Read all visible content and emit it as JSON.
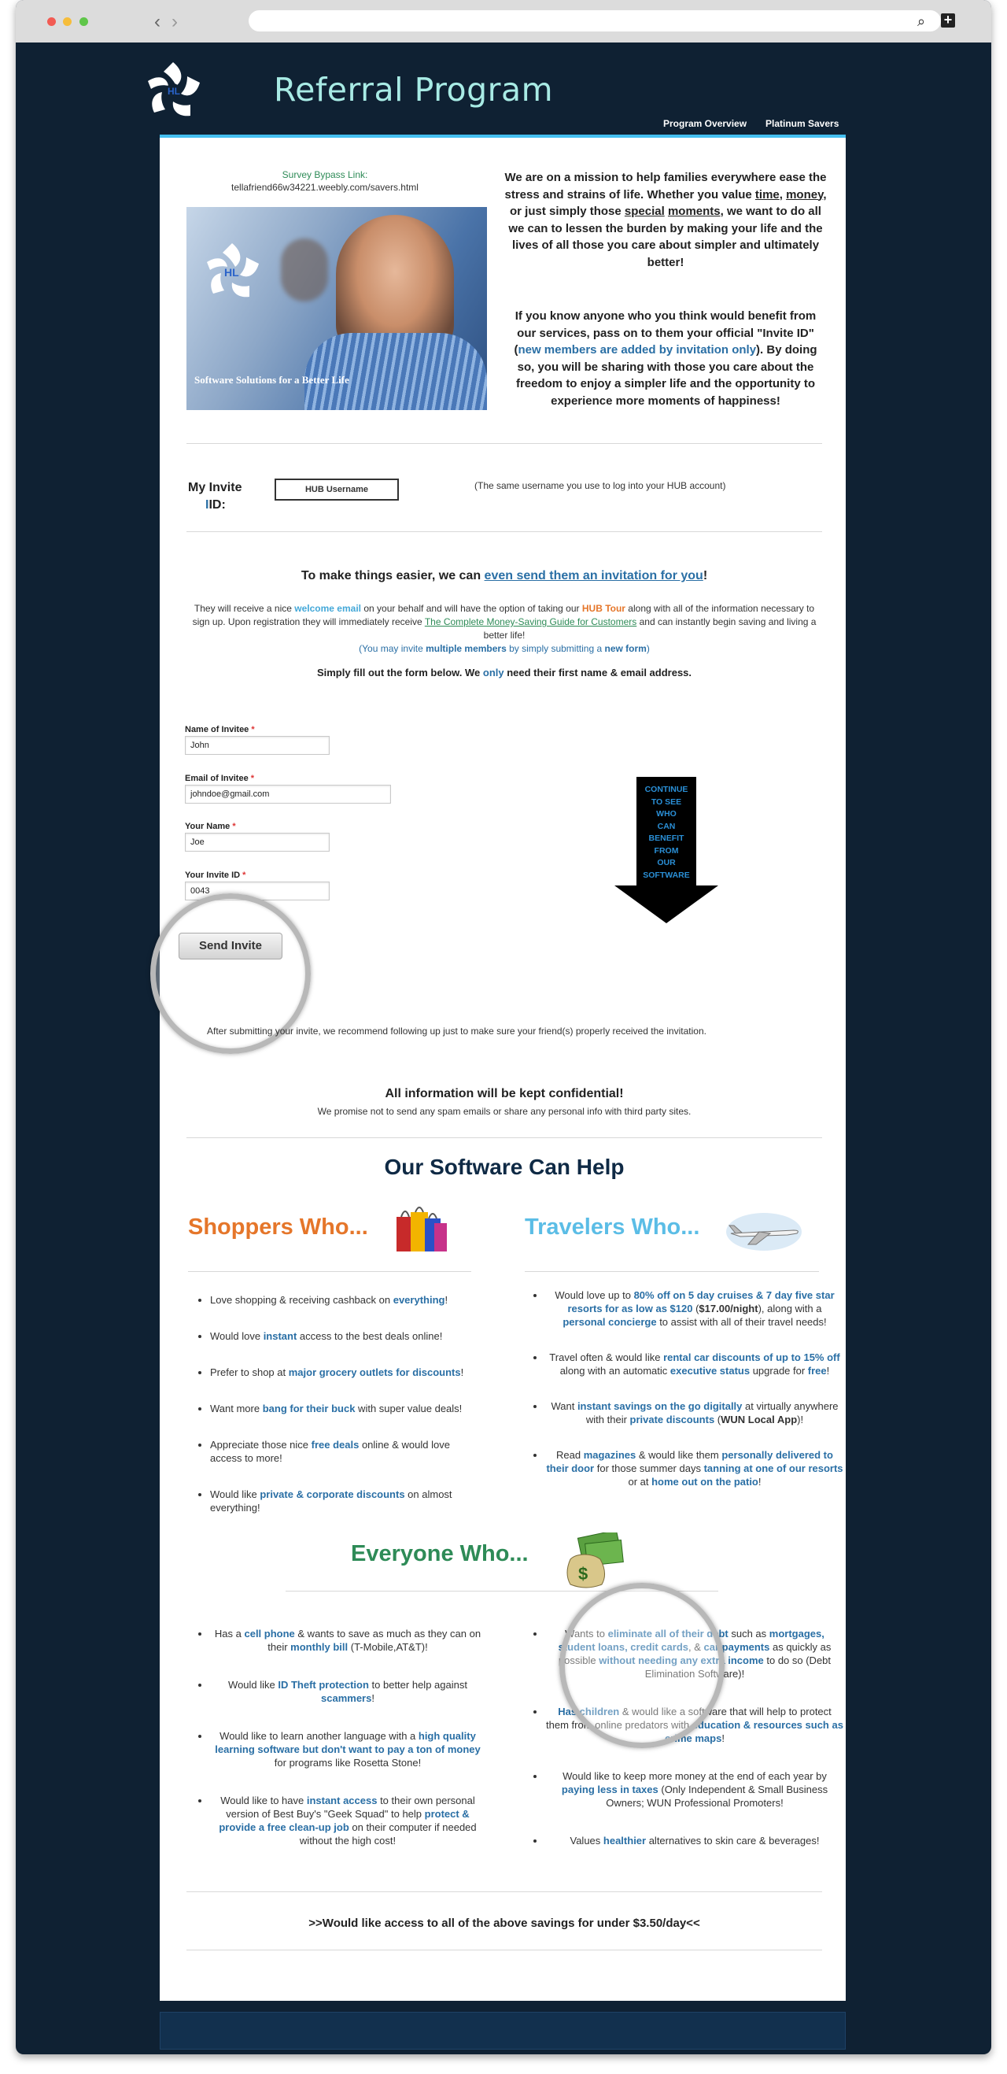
{
  "site": {
    "title": "Referral Program",
    "nav": [
      "Program Overview",
      "Platinum Savers"
    ]
  },
  "survey": {
    "label": "Survey Bypass Link:",
    "url": "tellafriend66w34221.weebly.com/savers.html"
  },
  "hero": {
    "caption": "Software Solutions for a Better Life",
    "logo_text": "HL"
  },
  "mission": {
    "p1": [
      "We are on a mission to help families everywhere ease the stress and strains of life. Whether you value ",
      "time",
      ", ",
      "money",
      ", or just simply those ",
      "special",
      " ",
      "moments",
      ", we want to do all we can to lessen the burden by making your life and the lives of all those you care about simpler and ultimately better!"
    ],
    "p2": [
      "If you know anyone who you think would benefit from our services, pass on to them your official \"Invite ID\" (",
      "new members are added by invitation only",
      "). By doing so, you will be sharing with those you care about the freedom to enjoy a simpler life and the opportunity to experience more moments of happiness!"
    ]
  },
  "invite_id": {
    "label_line1": "My Invite",
    "label_line2": "ID:",
    "box": "HUB Username",
    "note": "(The same username you use to log into your HUB account)"
  },
  "easier": {
    "lead": "To make things easier, we can ",
    "link": "even send them an invitation for you",
    "end": "!"
  },
  "info": {
    "a": "They will receive a nice ",
    "welcome": "welcome email",
    "b": " on your behalf and will have the option of taking our ",
    "tour": "HUB Tour",
    "c": " along with all of the information necessary to sign up. Upon registration they will immediately receive ",
    "guide": "The Complete Money-Saving Guide for Customers",
    "d": " and can instantly begin saving and living a better life!",
    "e": "(You may invite ",
    "multi": "multiple members",
    "f": " by simply submitting a ",
    "newform": "new form",
    "g": ")"
  },
  "fill": {
    "a": "Simply fill out the form below. We ",
    "only": "only",
    "b": " need their first name & email address."
  },
  "form": {
    "name_label": "Name of Invitee",
    "name_value": "John",
    "email_label": "Email of Invitee",
    "email_value": "johndoe@gmail.com",
    "your_name_label": "Your Name",
    "your_name_value": "Joe",
    "your_id_label": "Your Invite ID",
    "your_id_value": "0043",
    "required_mark": "*",
    "submit": "Send Invite"
  },
  "arrow": {
    "text": [
      "CONTINUE",
      "TO SEE",
      "WHO",
      "CAN",
      "BENEFIT",
      "FROM",
      "OUR",
      "SOFTWARE"
    ]
  },
  "follow_up": "After submitting your invite, we recommend following up just to make sure your friend(s) properly received the invitation.",
  "confidential": {
    "title": "All information will be kept confidential!",
    "text": "We promise not to send any spam emails or share any personal info with third party sites."
  },
  "software": {
    "title": "Our Software Can Help"
  },
  "shoppers": {
    "title": "Shoppers Who...",
    "items": [
      [
        "Love shopping & receiving cashback on ",
        "everything",
        "!"
      ],
      [
        "Would love ",
        "instant",
        " access to the best deals online!"
      ],
      [
        "Prefer to shop at ",
        "major grocery outlets for discounts",
        "!"
      ],
      [
        "Want more ",
        "bang for their buck",
        " with super value deals!"
      ],
      [
        "Appreciate those nice ",
        "free deals",
        " online & would love access to more!"
      ],
      [
        "Would like ",
        "private & corporate discounts",
        " on almost everything!"
      ]
    ]
  },
  "travelers": {
    "title": "Travelers Who...",
    "items": [
      [
        "Would love up to ",
        "80% off on 5 day cruises & 7 day five star resorts for as low as $120",
        " (",
        "$17.00/night",
        "), along with a ",
        "personal concierge",
        " to assist with all of their travel needs!"
      ],
      [
        "Travel often & would like ",
        "rental car discounts of up to 15% off",
        " along with an automatic ",
        "executive status",
        " upgrade for ",
        "free",
        "!"
      ],
      [
        "Want ",
        "instant savings on the go digitally",
        " at virtually anywhere with their ",
        "private discounts",
        " (",
        "WUN Local App",
        ")!"
      ],
      [
        "Read ",
        "magazines",
        " & would like them ",
        "personally delivered to their door",
        " for those summer days ",
        "tanning at one of our resorts",
        " or at ",
        "home out on the patio",
        "!"
      ]
    ]
  },
  "everyone": {
    "title": "Everyone Who...",
    "left": [
      [
        "Has a ",
        "cell phone",
        " & wants to save as much as they can on their ",
        "monthly bill",
        " (T-Mobile,AT&T)!"
      ],
      [
        "Would like ",
        "ID Theft protection",
        " to better help against ",
        "scammers",
        "!"
      ],
      [
        "Would like to learn another language with a ",
        "high quality learning software but don't want to pay a ton of money",
        " for programs like Rosetta Stone!"
      ],
      [
        "Would like to have ",
        "instant access",
        " to their own personal version of Best Buy's \"Geek Squad\" to help ",
        "protect & provide a free clean-up job",
        " on their computer if needed without the high cost!"
      ]
    ],
    "right": [
      [
        "Wants to ",
        "eliminate all of their debt",
        " such as ",
        "mortgages, student loans, credit cards",
        ", & ",
        "car payments",
        " as quickly as possible ",
        "without needing any extra income",
        " to do so (Debt Elimination Software)!"
      ],
      [
        "Has children",
        " & would like a software that will help to protect them from online predators with ",
        "education & resources such as crime maps",
        "!"
      ],
      [
        "Would like to keep more money at the end of each year by ",
        "paying less in taxes",
        " (Only Independent & Small Business Owners; WUN Professional Promoters!"
      ],
      [
        "Values ",
        "healthier",
        " alternatives to skin care & beverages!"
      ]
    ]
  },
  "bottom_line": ">>Would like access to all of the above savings for under $3.50/day<<",
  "colors": {
    "bg": "#0f2133",
    "accent": "#44bff0",
    "title": "#a8ebe5",
    "link_blue": "#2a6fa5",
    "orange": "#e5762a",
    "green": "#2e8b57",
    "shoppers": "#e5762a",
    "travelers": "#5bbde6",
    "everyone": "#2e8b57"
  }
}
